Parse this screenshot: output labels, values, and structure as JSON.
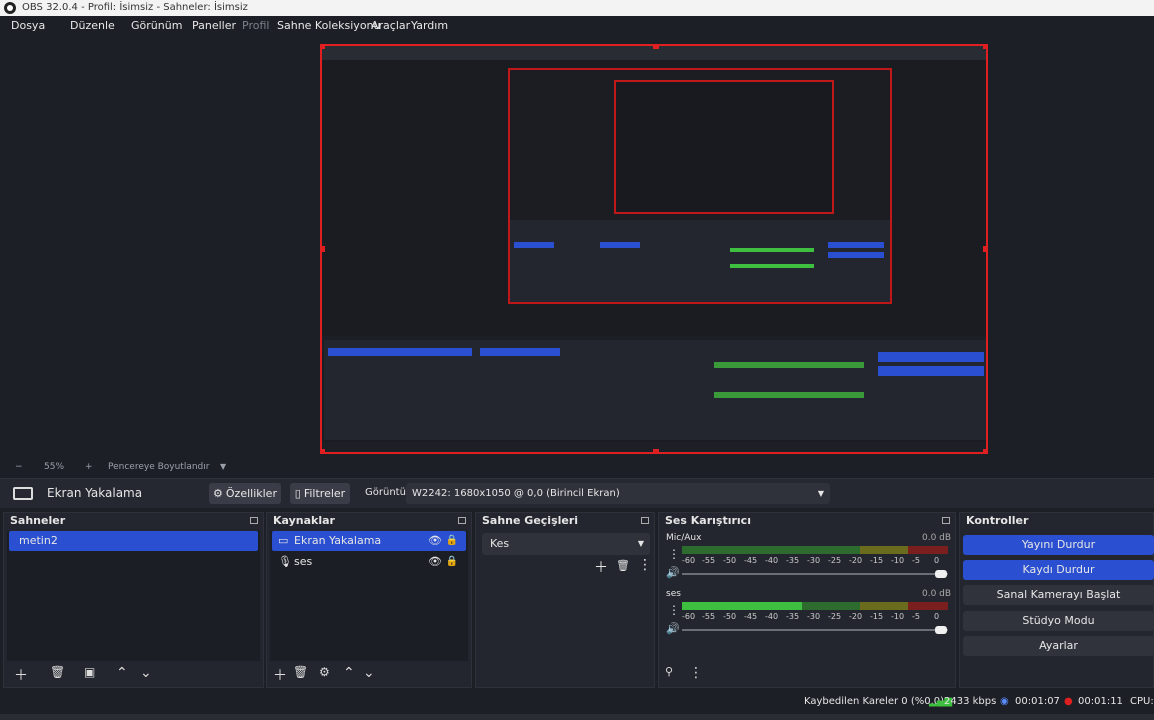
{
  "window": {
    "title": "OBS 32.0.4 - Profil: İsimsiz - Sahneler: İsimsiz"
  },
  "menu": [
    "Dosya",
    "Düzenle",
    "Görünüm",
    "Paneller",
    "Profil",
    "Sahne Koleksiyonu",
    "Araçlar",
    "Yardım"
  ],
  "zoom": {
    "minus": "−",
    "value": "55%",
    "plus": "+",
    "fit_label": "Pencereye Boyutlandır"
  },
  "source_toolbar": {
    "source_name": "Ekran Yakalama",
    "properties_label": "Özellikler",
    "filters_label": "Filtreler",
    "display_label": "Görüntü",
    "display_value": "W2242: 1680x1050 @ 0,0 (Birincil Ekran)"
  },
  "scenes": {
    "title": "Sahneler",
    "items": [
      "metin2"
    ]
  },
  "sources": {
    "title": "Kaynaklar",
    "items": [
      "Ekran Yakalama",
      "ses"
    ]
  },
  "transitions": {
    "title": "Sahne Geçişleri",
    "selected": "Kes"
  },
  "mixer": {
    "title": "Ses Karıştırıcı",
    "tracks": [
      {
        "name": "Mic/Aux",
        "db": "0.0 dB",
        "level": 0.0
      },
      {
        "name": "ses",
        "db": "0.0 dB",
        "level": 0.45
      }
    ],
    "ticks": [
      "-60",
      "-55",
      "-50",
      "-45",
      "-40",
      "-35",
      "-30",
      "-25",
      "-20",
      "-15",
      "-10",
      "-5",
      "0"
    ]
  },
  "controls": {
    "title": "Kontroller",
    "buttons": [
      "Yayını Durdur",
      "Kaydı Durdur",
      "Sanal Kamerayı Başlat",
      "Stüdyo Modu",
      "Ayarlar"
    ]
  },
  "status": {
    "dropped": "Kaybedilen Kareler 0 (%0.0)",
    "bitrate": "2433 kbps",
    "stream_time": "00:01:07",
    "rec_time": "00:01:11",
    "cpu": "CPU:"
  },
  "colors": {
    "accent": "#2a4fd0",
    "record": "#e02020",
    "meter_green": "#3fbf3f"
  }
}
